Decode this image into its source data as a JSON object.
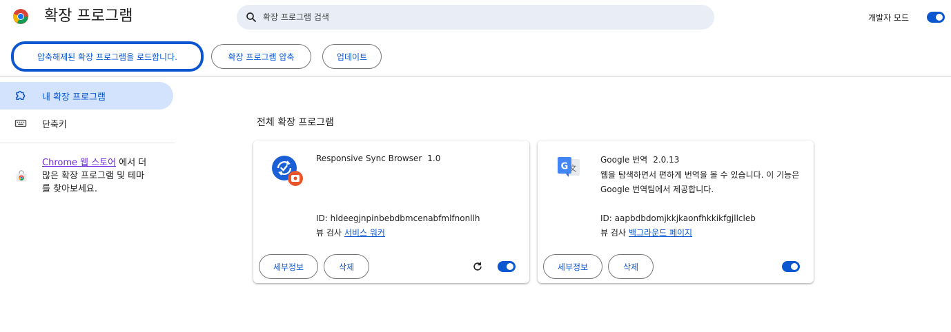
{
  "header": {
    "title": "확장 프로그램",
    "search_placeholder": "확장 프로그램 검색",
    "dev_mode_label": "개발자 모드",
    "dev_mode_on": true
  },
  "toolbar": {
    "load_unpacked": "압축해제된 확장 프로그램을 로드합니다.",
    "pack": "확장 프로그램 압축",
    "update": "업데이트"
  },
  "sidebar": {
    "items": [
      {
        "label": "내 확장 프로그램",
        "icon": "puzzle-icon",
        "active": true
      },
      {
        "label": "단축키",
        "icon": "keyboard-icon",
        "active": false
      }
    ],
    "store_link": "Chrome 웹 스토어",
    "store_text_line1_rest": " 에서 더",
    "store_text_line2": "많은 확장 프로그램 및 테마",
    "store_text_line3": "를 찾아보세요."
  },
  "main": {
    "section_title": "전체 확장 프로그램",
    "cards": [
      {
        "name": "Responsive Sync Browser",
        "version": "1.0",
        "description": "",
        "id_text": "ID: hldeegjnpinbebdbmcenabfmlfnonllh",
        "view_label": "뷰 검사",
        "view_link": "서비스 워커",
        "details": "세부정보",
        "remove": "삭제",
        "enabled": true,
        "has_reload": true
      },
      {
        "name": "Google 번역",
        "version": "2.0.13",
        "description": "웹을 탐색하면서 편하게 번역을 볼 수 있습니다. 이 기능은 Google 번역팀에서 제공합니다.",
        "id_text": "ID: aapbdbdomjkkjkaonfhkkikfgjllcleb",
        "view_label": "뷰 검사",
        "view_link": "백그라운드 페이지",
        "details": "세부정보",
        "remove": "삭제",
        "enabled": true,
        "has_reload": false
      }
    ]
  },
  "colors": {
    "accent": "#0b57d0",
    "active_bg": "#d3e3fd",
    "search_bg": "#e9eef6"
  }
}
